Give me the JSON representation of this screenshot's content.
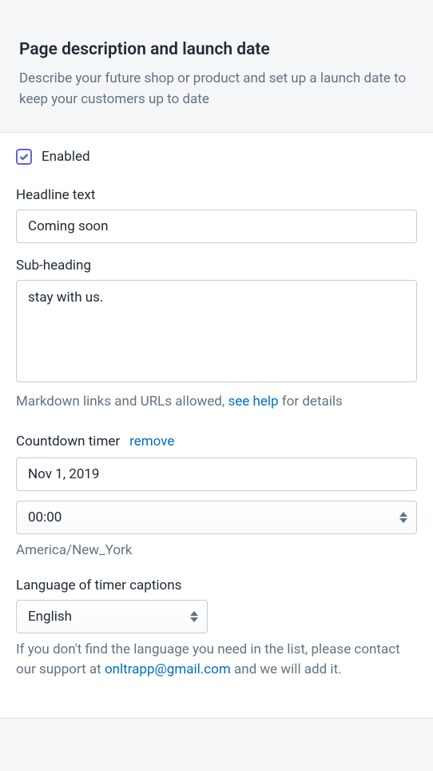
{
  "header": {
    "title": "Page description and launch date",
    "subtitle": "Describe your future shop or product and set up a launch date to keep your customers up to date"
  },
  "enabled": {
    "label": "Enabled",
    "checked": true
  },
  "headline": {
    "label": "Headline text",
    "value": "Coming soon"
  },
  "subheading": {
    "label": "Sub-heading",
    "value": "stay with us.",
    "help_prefix": "Markdown links and URLs allowed, ",
    "help_link": "see help",
    "help_suffix": " for details"
  },
  "countdown": {
    "label": "Countdown timer",
    "remove_label": "remove",
    "date_value": "Nov 1, 2019",
    "time_value": "00:00",
    "timezone": "America/New_York"
  },
  "language": {
    "label": "Language of timer captions",
    "value": "English",
    "help_prefix": "If you don't find the language you need in the list, please contact our support at ",
    "help_email": "onltrapp@gmail.com",
    "help_suffix": " and we will add it."
  }
}
